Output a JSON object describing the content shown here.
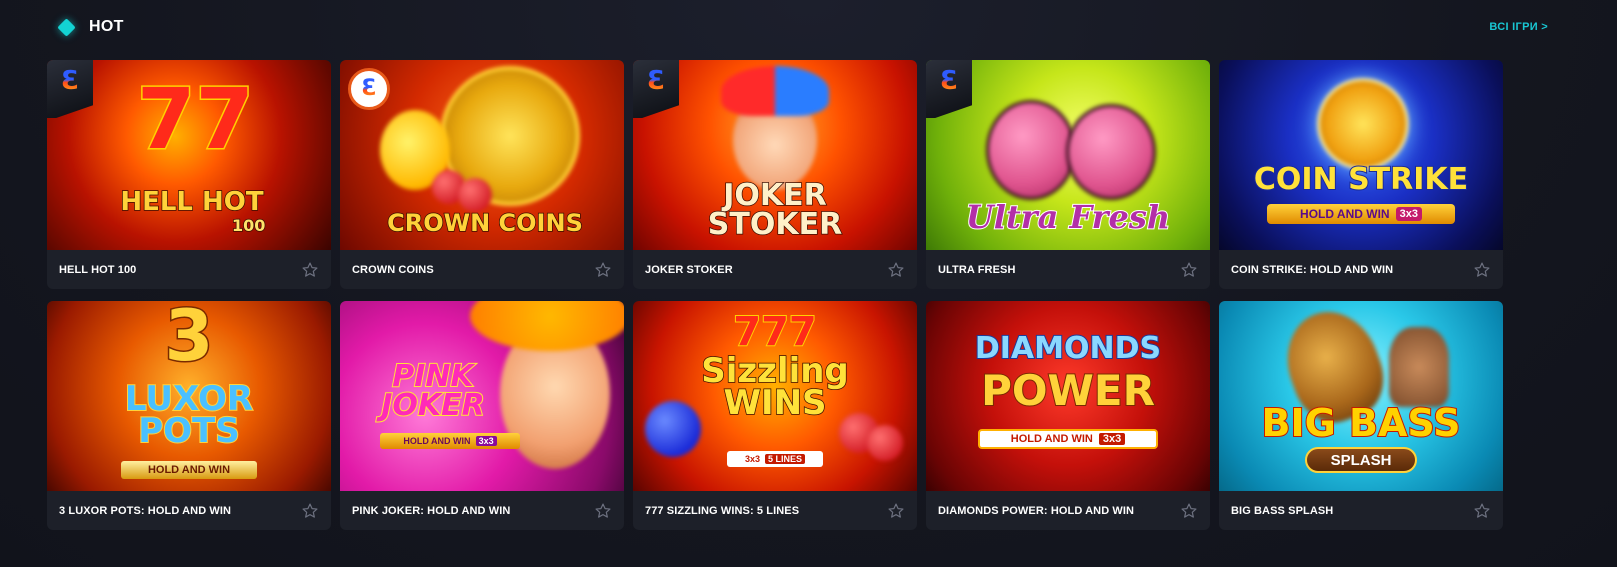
{
  "section": {
    "title": "HOT",
    "all_games_label": "ВСІ ІГРИ >"
  },
  "colors": {
    "accent": "#19c7d3",
    "card_bg": "#1d2029",
    "page_bg": "#14161f"
  },
  "games": [
    {
      "name": "HELL HOT 100",
      "art_title": "HELL HOT",
      "art_sub": "100",
      "art_num": "77",
      "provider_badge": "e-badge"
    },
    {
      "name": "CROWN COINS",
      "art_title": "CROWN COINS",
      "provider_badge": "e-round"
    },
    {
      "name": "JOKER STOKER",
      "art_title": "JOKER STOKER",
      "provider_badge": "e-badge"
    },
    {
      "name": "ULTRA FRESH",
      "art_title": "Ultra Fresh",
      "provider_badge": "e-badge"
    },
    {
      "name": "COIN STRIKE: HOLD AND WIN",
      "art_title": "COIN STRIKE",
      "art_sub": "HOLD AND WIN",
      "art_tag": "3x3"
    },
    {
      "name": "3 LUXOR POTS: HOLD AND WIN",
      "art_num": "3",
      "art_title": "LUXOR POTS",
      "art_sub": "HOLD AND WIN"
    },
    {
      "name": "PINK JOKER: HOLD AND WIN",
      "art_title": "PINK JOKER",
      "art_sub": "HOLD AND WIN",
      "art_tag": "3x3"
    },
    {
      "name": "777 SIZZLING WINS: 5 LINES",
      "art_num": "777",
      "art_title": "Sizzling WINS",
      "art_sub": "3x3",
      "art_tag": "5 LINES"
    },
    {
      "name": "DIAMONDS POWER: HOLD AND WIN",
      "art_title": "DIAMONDS",
      "art_title2": "POWER",
      "art_sub": "HOLD AND WIN",
      "art_tag": "3x3"
    },
    {
      "name": "BIG BASS SPLASH",
      "art_title": "BIG BASS",
      "art_sub": "SPLASH"
    }
  ]
}
